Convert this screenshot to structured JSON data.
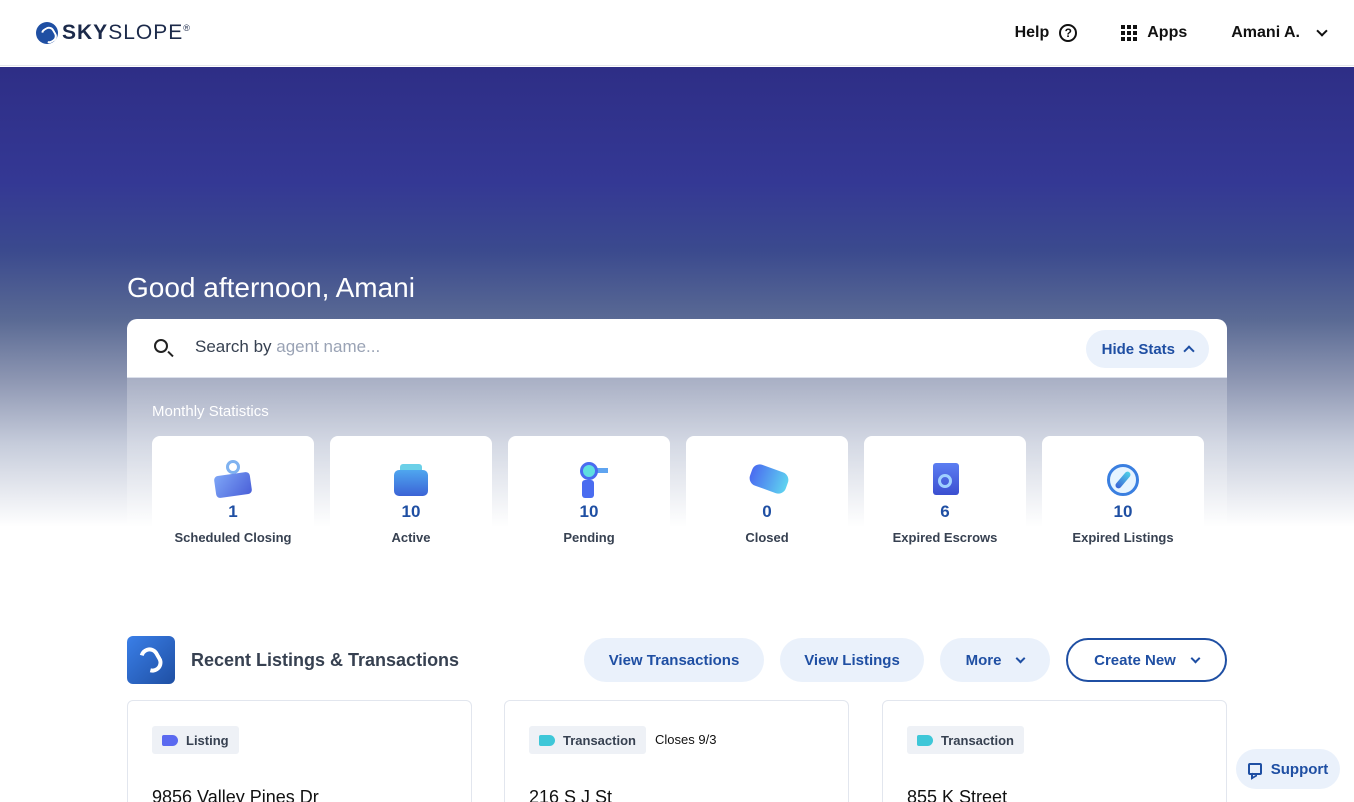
{
  "header": {
    "logo_text_bold": "SKY",
    "logo_text_rest": "SLOPE",
    "logo_mark": "®",
    "help_label": "Help",
    "help_icon": "question-circle-icon",
    "apps_label": "Apps",
    "apps_icon": "grid-icon",
    "user_label": "Amani A."
  },
  "hero": {
    "greeting": "Good afternoon, Amani"
  },
  "search": {
    "prefix": "Search by ",
    "placeholder": "agent name...",
    "hide_stats_label": "Hide Stats"
  },
  "stats": {
    "title": "Monthly Statistics",
    "items": [
      {
        "value": "1",
        "label": "Scheduled Closing",
        "icon": "hanging-sign-icon"
      },
      {
        "value": "10",
        "label": "Active",
        "icon": "toolbox-icon"
      },
      {
        "value": "10",
        "label": "Pending",
        "icon": "key-tag-icon"
      },
      {
        "value": "0",
        "label": "Closed",
        "icon": "telescope-icon"
      },
      {
        "value": "6",
        "label": "Expired Escrows",
        "icon": "document-search-icon"
      },
      {
        "value": "10",
        "label": "Expired Listings",
        "icon": "compass-icon"
      }
    ]
  },
  "recent": {
    "title": "Recent Listings & Transactions",
    "view_transactions": "View Transactions",
    "view_listings": "View Listings",
    "more": "More",
    "create_new": "Create New",
    "cards": [
      {
        "tag": "Listing",
        "tag_color": "#5b6af0",
        "closes": "",
        "address": "9856 Valley Pines Dr"
      },
      {
        "tag": "Transaction",
        "tag_color": "#3ec7d8",
        "closes": "Closes 9/3",
        "address": "216 S J St"
      },
      {
        "tag": "Transaction",
        "tag_color": "#3ec7d8",
        "closes": "",
        "address": "855 K Street"
      }
    ]
  },
  "support": {
    "label": "Support"
  }
}
